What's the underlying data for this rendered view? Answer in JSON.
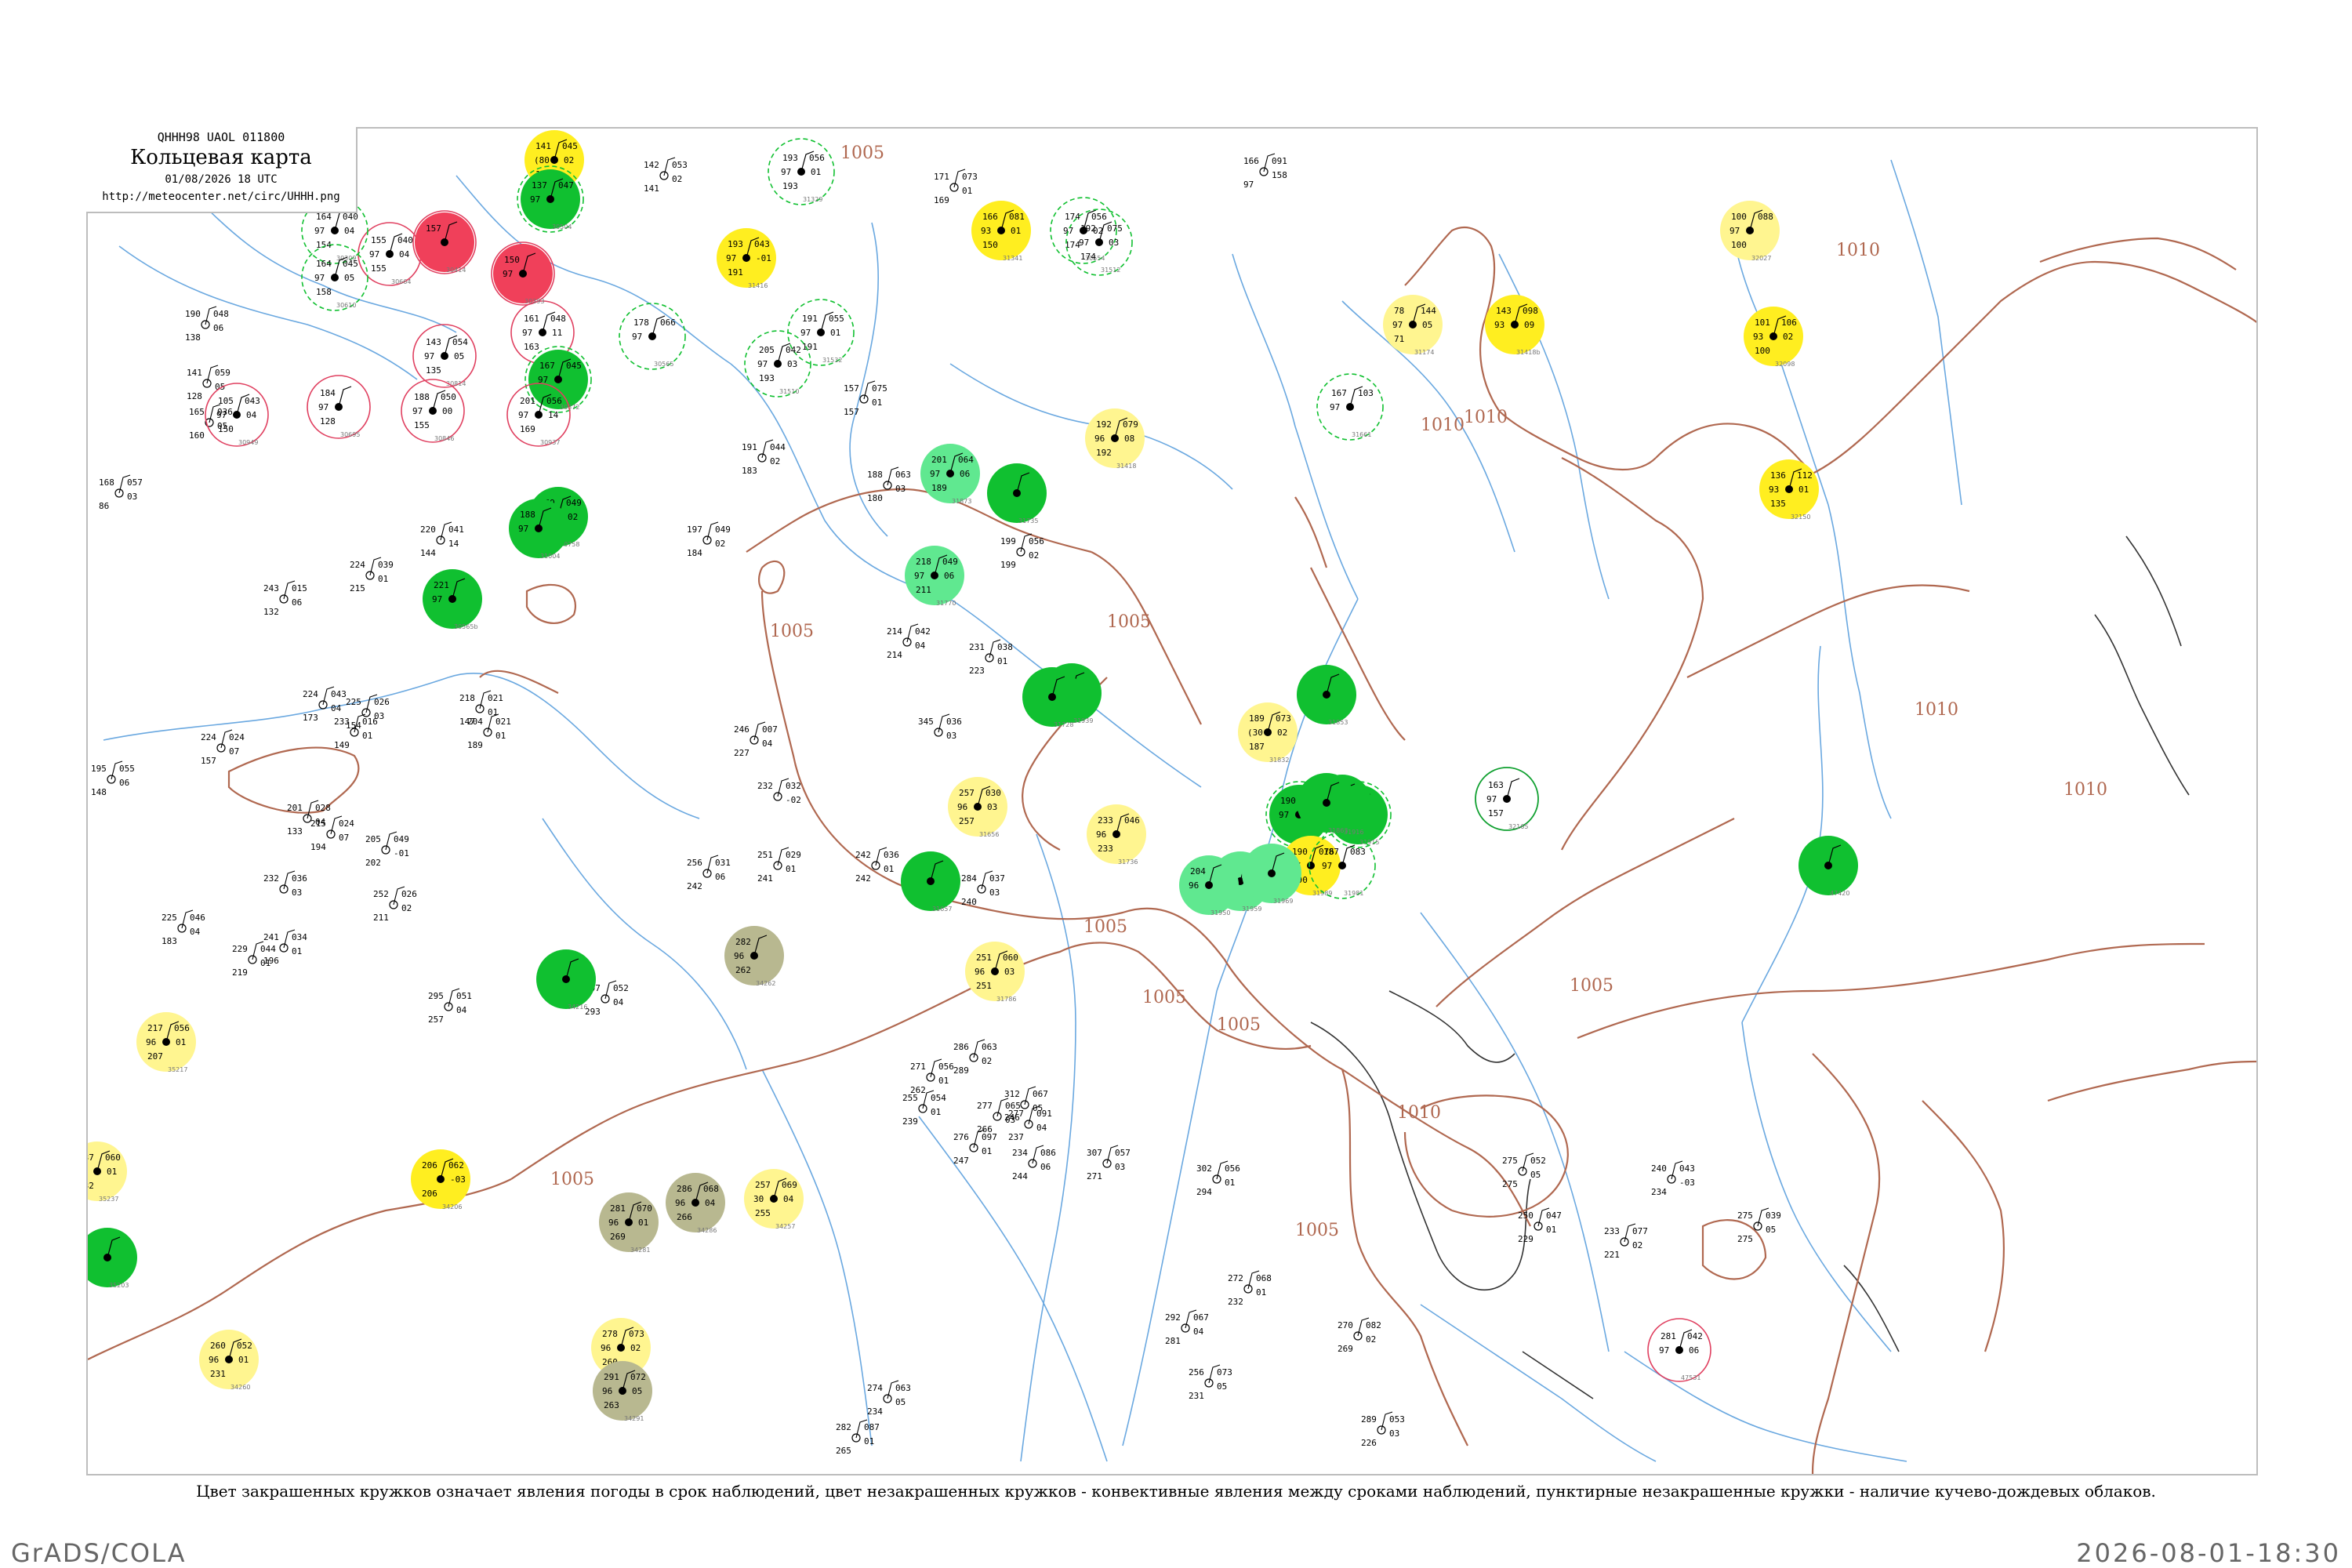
{
  "header": {
    "code": "QHHH98  UAOL  011800",
    "title": "Кольцевая карта",
    "date": "01/08/2026 18 UTC",
    "url": "http://meteocenter.net/circ/UHHH.png"
  },
  "caption": "Цвет закрашенных кружков означает явления погоды в срок наблюдений, цвет незакрашенных кружков - конвективные явления между сроками наблюдений, пунктирные незакрашенные кружки - наличие кучево-дождевых облаков.",
  "footer": {
    "left": "GrADS/COLA",
    "right": "2026-08-01-18:30"
  },
  "colors": {
    "isobar": "#b06850",
    "river": "#6aa8e0",
    "coast": "#333333",
    "red": "#f0405a",
    "green": "#10c030",
    "light_green": "#60e890",
    "yellow": "#ffee20",
    "light_yellow": "#fff590",
    "olive": "#b8b890"
  },
  "isobars": [
    {
      "label": "1005"
    },
    {
      "label": "1005"
    },
    {
      "label": "1005"
    },
    {
      "label": "1005"
    },
    {
      "label": "1005"
    },
    {
      "label": "1005"
    },
    {
      "label": "1005"
    },
    {
      "label": "1005"
    },
    {
      "label": "1005"
    },
    {
      "label": "1010"
    },
    {
      "label": "1010"
    },
    {
      "label": "1010"
    },
    {
      "label": "1010"
    },
    {
      "label": "1010"
    },
    {
      "label": "1010"
    }
  ],
  "stations": [
    {
      "id": "31532",
      "top": "191",
      "mid": "97",
      "bot": "191",
      "right1": "055",
      "right2": "01",
      "fill": "none",
      "ring": "green-dash"
    },
    {
      "id": "31329",
      "top": "193",
      "mid": "97",
      "bot": "193",
      "right1": "056",
      "right2": "01",
      "fill": "none",
      "ring": "green-dash"
    },
    {
      "id": "31416",
      "top": "193",
      "mid": "97",
      "bot": "191",
      "right1": "043",
      "right2": "-01",
      "fill": "yellow",
      "ring": "none"
    },
    {
      "id": "31510",
      "top": "205",
      "mid": "97",
      "bot": "193",
      "right1": "042",
      "right2": "03",
      "fill": "none",
      "ring": "green-dash"
    },
    {
      "id": "30554",
      "top": "174",
      "mid": "97",
      "bot": "174",
      "right1": "056",
      "right2": "02",
      "fill": "none",
      "ring": "green-dash"
    },
    {
      "id": "30758",
      "top": "169",
      "mid": "97",
      "bot": "168",
      "right1": "049",
      "right2": "02",
      "fill": "green",
      "ring": "none"
    },
    {
      "id": "30565",
      "top": "178",
      "mid": "97",
      "bot": "",
      "right1": "066",
      "right2": "",
      "fill": "none",
      "ring": "green-dash"
    },
    {
      "id": "30253",
      "top": "161",
      "mid": "97",
      "bot": "163",
      "right1": "048",
      "right2": "11",
      "fill": "none",
      "ring": "red"
    },
    {
      "id": "30372",
      "top": "167",
      "mid": "97",
      "bot": "",
      "right1": "045",
      "right2": "",
      "fill": "green",
      "ring": "green-dash"
    },
    {
      "id": "30664",
      "top": "155",
      "mid": "97",
      "bot": "155",
      "right1": "040",
      "right2": "04",
      "fill": "none",
      "ring": "red"
    },
    {
      "id": "30636",
      "top": "141",
      "mid": "(80",
      "bot": "141",
      "right1": "045",
      "right2": "02",
      "fill": "yellow",
      "ring": "none"
    },
    {
      "id": "30504",
      "top": "137",
      "mid": "97",
      "bot": "",
      "right1": "047",
      "right2": "",
      "fill": "green",
      "ring": "green-dash"
    },
    {
      "id": "30414",
      "top": "157",
      "mid": "",
      "bot": "",
      "right1": "",
      "right2": "",
      "fill": "red",
      "ring": "red"
    },
    {
      "id": "30393",
      "top": "150",
      "mid": "97",
      "bot": "",
      "right1": "",
      "right2": "",
      "fill": "red",
      "ring": "red"
    },
    {
      "id": "30309",
      "top": "164",
      "mid": "97",
      "bot": "154",
      "right1": "040",
      "right2": "04",
      "fill": "none",
      "ring": "green-dash"
    },
    {
      "id": "30610",
      "top": "164",
      "mid": "97",
      "bot": "158",
      "right1": "045",
      "right2": "05",
      "fill": "none",
      "ring": "green-dash"
    },
    {
      "id": "30814",
      "top": "143",
      "mid": "97",
      "bot": "135",
      "right1": "054",
      "right2": "05",
      "fill": "none",
      "ring": "red"
    },
    {
      "id": "30846",
      "top": "188",
      "mid": "97",
      "bot": "155",
      "right1": "050",
      "right2": "00",
      "fill": "none",
      "ring": "red"
    },
    {
      "id": "30937",
      "top": "201",
      "mid": "97",
      "bot": "169",
      "right1": "056",
      "right2": "14",
      "fill": "none",
      "ring": "red"
    },
    {
      "id": "30949",
      "top": "105",
      "mid": "97",
      "bot": "150",
      "right1": "043",
      "right2": "04",
      "fill": "none",
      "ring": "red"
    },
    {
      "id": "30695",
      "top": "184",
      "mid": "97",
      "bot": "128",
      "right1": "",
      "right2": "",
      "fill": "none",
      "ring": "red"
    },
    {
      "id": "31004",
      "top": "188",
      "mid": "97",
      "bot": "",
      "right1": "",
      "right2": "",
      "fill": "green",
      "ring": "none"
    },
    {
      "id": "30565b",
      "top": "221",
      "mid": "97",
      "bot": "",
      "right1": "",
      "right2": "",
      "fill": "green",
      "ring": "none"
    },
    {
      "id": "31873",
      "top": "201",
      "mid": "97",
      "bot": "189",
      "right1": "064",
      "right2": "06",
      "fill": "light_green",
      "ring": "none"
    },
    {
      "id": "31735",
      "top": "",
      "mid": "",
      "bot": "",
      "right1": "",
      "right2": "",
      "fill": "green",
      "ring": "none"
    },
    {
      "id": "31770",
      "top": "218",
      "mid": "97",
      "bot": "211",
      "right1": "049",
      "right2": "06",
      "fill": "light_green",
      "ring": "none"
    },
    {
      "id": "31939",
      "top": "",
      "mid": "",
      "bot": "",
      "right1": "",
      "right2": "",
      "fill": "green",
      "ring": "none"
    },
    {
      "id": "31418",
      "top": "192",
      "mid": "96",
      "bot": "192",
      "right1": "079",
      "right2": "08",
      "fill": "light_yellow",
      "ring": "none"
    },
    {
      "id": "31512",
      "top": "192",
      "mid": "97",
      "bot": "174",
      "right1": "075",
      "right2": "03",
      "fill": "none",
      "ring": "green-dash"
    },
    {
      "id": "31341",
      "top": "166",
      "mid": "93",
      "bot": "150",
      "right1": "081",
      "right2": "01",
      "fill": "yellow",
      "ring": "none"
    },
    {
      "id": "31661",
      "top": "167",
      "mid": "97",
      "bot": "",
      "right1": "103",
      "right2": "",
      "fill": "none",
      "ring": "green-dash"
    },
    {
      "id": "31832",
      "top": "189",
      "mid": "(30",
      "bot": "187",
      "right1": "073",
      "right2": "02",
      "fill": "light_yellow",
      "ring": "none"
    },
    {
      "id": "31853",
      "top": "",
      "mid": "",
      "bot": "",
      "right1": "",
      "right2": "",
      "fill": "green",
      "ring": "none"
    },
    {
      "id": "31960",
      "top": "190",
      "mid": "97",
      "bot": "",
      "right1": "",
      "right2": "",
      "fill": "green",
      "ring": "green-dash"
    },
    {
      "id": "31915",
      "top": "",
      "mid": "",
      "bot": "",
      "right1": "",
      "right2": "",
      "fill": "green",
      "ring": "green-dash"
    },
    {
      "id": "31989",
      "top": "190",
      "mid": "97",
      "bot": "190",
      "right1": "076",
      "right2": "",
      "fill": "yellow",
      "ring": "none"
    },
    {
      "id": "31981",
      "top": "187",
      "mid": "97",
      "bot": "",
      "right1": "083",
      "right2": "",
      "fill": "none",
      "ring": "green-dash"
    },
    {
      "id": "31959",
      "top": "",
      "mid": "",
      "bot": "",
      "right1": "074",
      "right2": "06",
      "fill": "light_green",
      "ring": "none"
    },
    {
      "id": "31969",
      "top": "",
      "mid": "",
      "bot": "",
      "right1": "",
      "right2": "",
      "fill": "light_green",
      "ring": "none"
    },
    {
      "id": "31950",
      "top": "204",
      "mid": "96",
      "bot": "",
      "right1": "",
      "right2": "",
      "fill": "light_green",
      "ring": "none"
    },
    {
      "id": "31174",
      "top": "78",
      "mid": "97",
      "bot": "71",
      "right1": "144",
      "right2": "05",
      "fill": "light_yellow",
      "ring": "none"
    },
    {
      "id": "31418b",
      "top": "143",
      "mid": "93",
      "bot": "",
      "right1": "098",
      "right2": "09",
      "fill": "yellow",
      "ring": "none"
    },
    {
      "id": "32098",
      "top": "101",
      "mid": "93",
      "bot": "100",
      "right1": "106",
      "right2": "02",
      "fill": "yellow",
      "ring": "none"
    },
    {
      "id": "32027",
      "top": "100",
      "mid": "97",
      "bot": "100",
      "right1": "088",
      "right2": "",
      "fill": "light_yellow",
      "ring": "none"
    },
    {
      "id": "32150",
      "top": "136",
      "mid": "93",
      "bot": "135",
      "right1": "112",
      "right2": "01",
      "fill": "yellow",
      "ring": "none"
    },
    {
      "id": "32165",
      "top": "163",
      "mid": "97",
      "bot": "157",
      "right1": "",
      "right2": "",
      "fill": "none",
      "ring": "green"
    },
    {
      "id": "47420",
      "top": "",
      "mid": "",
      "bot": "",
      "right1": "",
      "right2": "",
      "fill": "green",
      "ring": "none"
    },
    {
      "id": "31656",
      "top": "257",
      "mid": "96",
      "bot": "257",
      "right1": "030",
      "right2": "03",
      "fill": "light_yellow",
      "ring": "none"
    },
    {
      "id": "31736",
      "top": "233",
      "mid": "96",
      "bot": "233",
      "right1": "046",
      "right2": "",
      "fill": "light_yellow",
      "ring": "none"
    },
    {
      "id": "31786",
      "top": "251",
      "mid": "96",
      "bot": "251",
      "right1": "060",
      "right2": "03",
      "fill": "light_yellow",
      "ring": "none"
    },
    {
      "id": "31657",
      "top": "",
      "mid": "",
      "bot": "",
      "right1": "",
      "right2": "",
      "fill": "green",
      "ring": "none"
    },
    {
      "id": "31728",
      "top": "",
      "mid": "",
      "bot": "",
      "right1": "",
      "right2": "",
      "fill": "green",
      "ring": "none"
    },
    {
      "id": "31916",
      "top": "",
      "mid": "",
      "bot": "",
      "right1": "",
      "right2": "",
      "fill": "green",
      "ring": "none"
    },
    {
      "id": "31863",
      "top": "",
      "mid": "",
      "bot": "",
      "right1": "",
      "right2": "",
      "fill": "green",
      "ring": "none"
    },
    {
      "id": "34262",
      "top": "282",
      "mid": "96",
      "bot": "262",
      "right1": "",
      "right2": "",
      "fill": "olive",
      "ring": "none"
    },
    {
      "id": "34216",
      "top": "",
      "mid": "",
      "bot": "",
      "right1": "",
      "right2": "",
      "fill": "green",
      "ring": "none"
    },
    {
      "id": "35217",
      "top": "217",
      "mid": "96",
      "bot": "207",
      "right1": "056",
      "right2": "01",
      "fill": "light_yellow",
      "ring": "none"
    },
    {
      "id": "35237",
      "top": "237",
      "mid": "96",
      "bot": "232",
      "right1": "060",
      "right2": "01",
      "fill": "light_yellow",
      "ring": "none"
    },
    {
      "id": "35203",
      "top": "",
      "mid": "",
      "bot": "",
      "right1": "",
      "right2": "",
      "fill": "green",
      "ring": "none"
    },
    {
      "id": "34206",
      "top": "206",
      "mid": "",
      "bot": "206",
      "right1": "062",
      "right2": "-03",
      "fill": "yellow",
      "ring": "none"
    },
    {
      "id": "34281",
      "top": "281",
      "mid": "96",
      "bot": "269",
      "right1": "070",
      "right2": "01",
      "fill": "olive",
      "ring": "none"
    },
    {
      "id": "34286",
      "top": "286",
      "mid": "96",
      "bot": "266",
      "right1": "068",
      "right2": "04",
      "fill": "olive",
      "ring": "none"
    },
    {
      "id": "34257",
      "top": "257",
      "mid": "30",
      "bot": "255",
      "right1": "069",
      "right2": "04",
      "fill": "light_yellow",
      "ring": "none"
    },
    {
      "id": "34278",
      "top": "278",
      "mid": "96",
      "bot": "260",
      "right1": "073",
      "right2": "02",
      "fill": "light_yellow",
      "ring": "none"
    },
    {
      "id": "34291",
      "top": "291",
      "mid": "96",
      "bot": "263",
      "right1": "072",
      "right2": "05",
      "fill": "olive",
      "ring": "none"
    },
    {
      "id": "34260",
      "top": "260",
      "mid": "96",
      "bot": "231",
      "right1": "052",
      "right2": "01",
      "fill": "light_yellow",
      "ring": "none"
    },
    {
      "id": "47531",
      "top": "281",
      "mid": "97",
      "bot": "",
      "right1": "042",
      "right2": "06",
      "fill": "none",
      "ring": "red"
    }
  ],
  "plain_stations": [
    {
      "a": "142",
      "b": "053",
      "c": "141",
      "d": "02"
    },
    {
      "a": "171",
      "b": "073",
      "c": "169",
      "d": "01"
    },
    {
      "a": "166",
      "b": "091",
      "c": "97",
      "d": "158"
    },
    {
      "a": "190",
      "b": "048",
      "c": "138",
      "d": "06"
    },
    {
      "a": "141",
      "b": "059",
      "c": "128",
      "d": "05"
    },
    {
      "a": "165",
      "b": "036",
      "c": "160",
      "d": "05"
    },
    {
      "a": "168",
      "b": "057",
      "c": "86",
      "d": "03"
    },
    {
      "a": "243",
      "b": "015",
      "c": "132",
      "d": "06"
    },
    {
      "a": "224",
      "b": "039",
      "c": "215",
      "d": "01"
    },
    {
      "a": "220",
      "b": "041",
      "c": "144",
      "d": "14"
    },
    {
      "a": "197",
      "b": "049",
      "c": "184",
      "d": "02"
    },
    {
      "a": "191",
      "b": "044",
      "c": "183",
      "d": "02"
    },
    {
      "a": "157",
      "b": "075",
      "c": "157",
      "d": "01"
    },
    {
      "a": "188",
      "b": "063",
      "c": "180",
      "d": "03"
    },
    {
      "a": "199",
      "b": "056",
      "c": "199",
      "d": "02"
    },
    {
      "a": "214",
      "b": "042",
      "c": "214",
      "d": "04"
    },
    {
      "a": "231",
      "b": "038",
      "c": "223",
      "d": "01"
    },
    {
      "a": "224",
      "b": "043",
      "c": "173",
      "d": "04"
    },
    {
      "a": "225",
      "b": "026",
      "c": "154",
      "d": "03"
    },
    {
      "a": "233",
      "b": "016",
      "c": "149",
      "d": "01"
    },
    {
      "a": "218",
      "b": "021",
      "c": "147",
      "d": "01"
    },
    {
      "a": "204",
      "b": "021",
      "c": "189",
      "d": "01"
    },
    {
      "a": "195",
      "b": "055",
      "c": "148",
      "d": "06"
    },
    {
      "a": "224",
      "b": "024",
      "c": "157",
      "d": "07"
    },
    {
      "a": "246",
      "b": "007",
      "c": "227",
      "d": "04"
    },
    {
      "a": "345",
      "b": "036",
      "c": "",
      "d": "03"
    },
    {
      "a": "232",
      "b": "032",
      "c": "",
      "d": "-02"
    },
    {
      "a": "201",
      "b": "028",
      "c": "133",
      "d": "04"
    },
    {
      "a": "215",
      "b": "024",
      "c": "194",
      "d": "07"
    },
    {
      "a": "205",
      "b": "049",
      "c": "202",
      "d": "-01"
    },
    {
      "a": "225",
      "b": "046",
      "c": "183",
      "d": "04"
    },
    {
      "a": "241",
      "b": "034",
      "c": "196",
      "d": "01"
    },
    {
      "a": "229",
      "b": "044",
      "c": "219",
      "d": "01"
    },
    {
      "a": "232",
      "b": "036",
      "c": "",
      "d": "03"
    },
    {
      "a": "252",
      "b": "026",
      "c": "211",
      "d": "02"
    },
    {
      "a": "256",
      "b": "031",
      "c": "242",
      "d": "06"
    },
    {
      "a": "242",
      "b": "036",
      "c": "242",
      "d": "01"
    },
    {
      "a": "251",
      "b": "029",
      "c": "241",
      "d": "01"
    },
    {
      "a": "284",
      "b": "037",
      "c": "240",
      "d": "03"
    },
    {
      "a": "295",
      "b": "051",
      "c": "257",
      "d": "04"
    },
    {
      "a": "307",
      "b": "052",
      "c": "293",
      "d": "04"
    },
    {
      "a": "286",
      "b": "063",
      "c": "289",
      "d": "02"
    },
    {
      "a": "277",
      "b": "065",
      "c": "266",
      "d": "03"
    },
    {
      "a": "271",
      "b": "056",
      "c": "262",
      "d": "01"
    },
    {
      "a": "255",
      "b": "054",
      "c": "239",
      "d": "01"
    },
    {
      "a": "276",
      "b": "097",
      "c": "247",
      "d": "01"
    },
    {
      "a": "312",
      "b": "067",
      "c": "246",
      "d": "05"
    },
    {
      "a": "277",
      "b": "091",
      "c": "237",
      "d": "04"
    },
    {
      "a": "234",
      "b": "086",
      "c": "244",
      "d": "06"
    },
    {
      "a": "307",
      "b": "057",
      "c": "271",
      "d": "03"
    },
    {
      "a": "302",
      "b": "056",
      "c": "294",
      "d": "01"
    },
    {
      "a": "292",
      "b": "067",
      "c": "281",
      "d": "04"
    },
    {
      "a": "275",
      "b": "052",
      "c": "275",
      "d": "05"
    },
    {
      "a": "250",
      "b": "047",
      "c": "229",
      "d": "01"
    },
    {
      "a": "240",
      "b": "043",
      "c": "234",
      "d": "-03"
    },
    {
      "a": "233",
      "b": "077",
      "c": "221",
      "d": "02"
    },
    {
      "a": "275",
      "b": "039",
      "c": "275",
      "d": "05"
    },
    {
      "a": "272",
      "b": "068",
      "c": "232",
      "d": "01"
    },
    {
      "a": "270",
      "b": "082",
      "c": "269",
      "d": "02"
    },
    {
      "a": "256",
      "b": "073",
      "c": "231",
      "d": "05"
    },
    {
      "a": "274",
      "b": "063",
      "c": "234",
      "d": "05"
    },
    {
      "a": "282",
      "b": "087",
      "c": "265",
      "d": "01"
    },
    {
      "a": "289",
      "b": "053",
      "c": "226",
      "d": "03"
    }
  ]
}
